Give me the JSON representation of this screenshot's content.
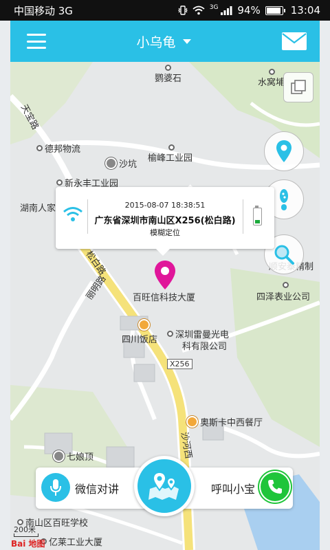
{
  "status_bar": {
    "carrier": "中国移动 3G",
    "network": "3G",
    "battery": "94%",
    "battery_level": 0.94,
    "time": "13:04"
  },
  "header": {
    "device_name": "小乌龟"
  },
  "map": {
    "pois": [
      {
        "label": "鹦婆石"
      },
      {
        "label": "水窝埔"
      },
      {
        "label": "德邦物流"
      },
      {
        "label": "沙坑"
      },
      {
        "label": "榆峰工业园"
      },
      {
        "label": "新永丰工业园"
      },
      {
        "label": "湖南人家"
      },
      {
        "label": "百旺信科技大厦"
      },
      {
        "label": "四泽表业公司"
      },
      {
        "label": "顺安泰精制"
      },
      {
        "label": "四川饭店"
      },
      {
        "label": "深圳雷曼光电"
      },
      {
        "label": "科有限公司"
      },
      {
        "label": "奥斯卡中西餐厅"
      },
      {
        "label": "七娘顶"
      },
      {
        "label": "南山区百旺学校"
      },
      {
        "label": "亿莱工业大厦"
      }
    ],
    "roads": [
      {
        "label": "天宝路"
      },
      {
        "label": "松白路"
      },
      {
        "label": "丽明路"
      },
      {
        "label": "沙河西"
      },
      {
        "label": "X256"
      }
    ],
    "scale_label": "200米",
    "logo_text": "Bai 地图"
  },
  "popup": {
    "timestamp": "2015-08-07 18:38:51",
    "address": "广东省深圳市南山区X256(松白路)",
    "locate_mode": "模糊定位",
    "device_battery_level": 0.3
  },
  "bottom_bar": {
    "intercom_label": "微信对讲",
    "call_label": "呼叫小宝"
  },
  "colors": {
    "accent": "#2ac0e6",
    "pin": "#e0169a",
    "call": "#1fc53a",
    "road_main": "#f5e27a"
  }
}
